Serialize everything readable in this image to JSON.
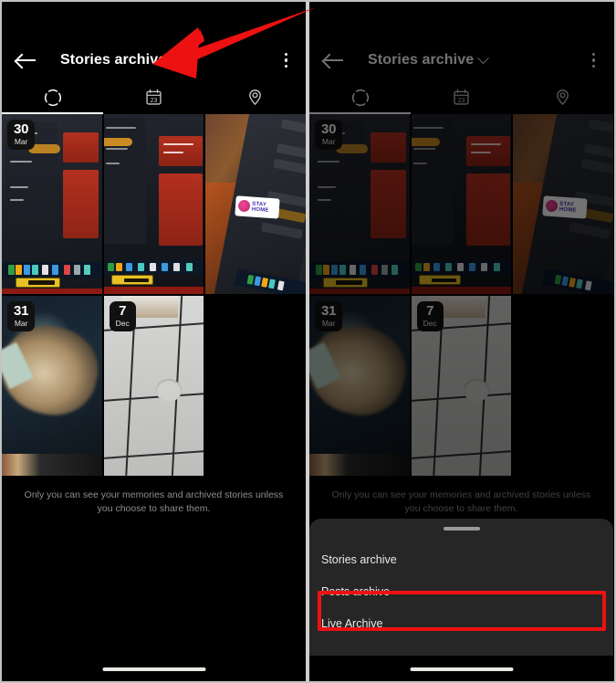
{
  "app": {
    "title": "Stories archive",
    "back_icon": "arrow-left-icon",
    "dropdown_icon": "chevron-down-icon",
    "overflow_icon": "kebab-menu-icon"
  },
  "tabs": [
    {
      "id": "stories",
      "icon": "stories-circle-icon",
      "active": true
    },
    {
      "id": "calendar",
      "icon": "calendar-icon",
      "calendar_day": "23",
      "active": false
    },
    {
      "id": "map",
      "icon": "location-pin-icon",
      "active": false
    }
  ],
  "grid": {
    "rows": [
      [
        {
          "art": "photo-a",
          "date_day": "30",
          "date_month": "Mar",
          "empty": false
        },
        {
          "art": "photo-b",
          "date_day": "",
          "date_month": "",
          "empty": false
        },
        {
          "art": "photo-c",
          "date_day": "",
          "date_month": "",
          "empty": false
        }
      ],
      [
        {
          "art": "photo-d",
          "date_day": "31",
          "date_month": "Mar",
          "empty": false
        },
        {
          "art": "photo-e",
          "date_day": "7",
          "date_month": "Dec",
          "empty": false
        },
        {
          "art": "",
          "date_day": "",
          "date_month": "",
          "empty": true
        }
      ]
    ]
  },
  "footer": {
    "note": "Only you can see your memories and archived stories unless you choose to share them."
  },
  "sheet": {
    "items": [
      {
        "label": "Stories archive",
        "highlighted": false
      },
      {
        "label": "Posts archive",
        "highlighted": true
      },
      {
        "label": "Live Archive",
        "highlighted": false
      }
    ]
  },
  "annotations": {
    "arrow_color": "#ee1111",
    "highlight_color": "#ee1111",
    "arrow_target": "stories-archive-dropdown-chevron"
  },
  "colors": {
    "panel_background": "#000000",
    "sheet_background": "#262626",
    "text_primary": "#ffffff",
    "text_secondary": "#8e8e8e",
    "accent_red": "#ee1111",
    "home_indicator": "#e8e8e4"
  },
  "sticker": {
    "line1": "STAY",
    "line2": "HOME"
  }
}
